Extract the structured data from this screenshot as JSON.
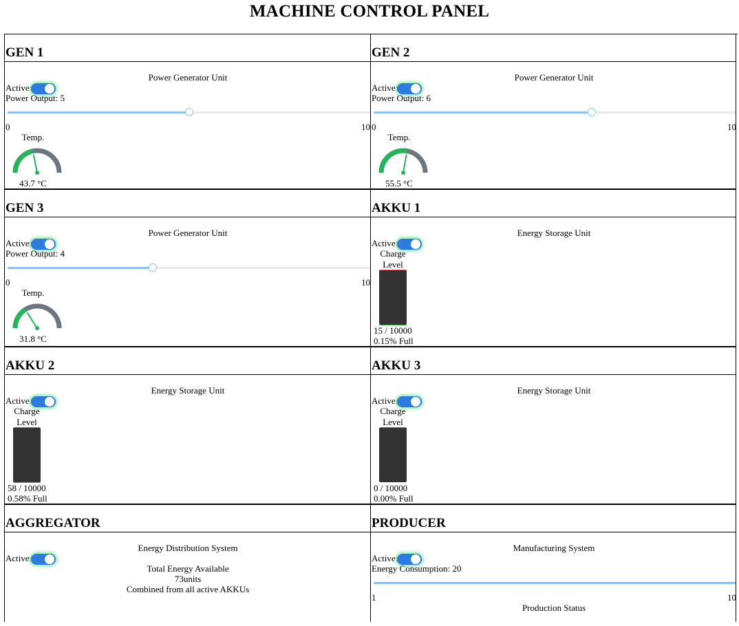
{
  "title": "MACHINE CONTROL PANEL",
  "gens": [
    {
      "name": "GEN 1",
      "subtitle": "Power Generator Unit",
      "active_label": "Active:",
      "active": true,
      "output_label": "Power Output: 5",
      "output": 5,
      "min": "0",
      "max": "10",
      "temp_label": "Temp.",
      "temp": 43.7,
      "temp_text": "43.7 °C"
    },
    {
      "name": "GEN 2",
      "subtitle": "Power Generator Unit",
      "active_label": "Active:",
      "active": true,
      "output_label": "Power Output: 6",
      "output": 6,
      "min": "0",
      "max": "10",
      "temp_label": "Temp.",
      "temp": 55.5,
      "temp_text": "55.5 °C"
    },
    {
      "name": "GEN 3",
      "subtitle": "Power Generator Unit",
      "active_label": "Active:",
      "active": true,
      "output_label": "Power Output: 4",
      "output": 4,
      "min": "0",
      "max": "10",
      "temp_label": "Temp.",
      "temp": 31.8,
      "temp_text": "31.8 °C"
    }
  ],
  "akkus": [
    {
      "name": "AKKU 1",
      "subtitle": "Energy Storage Unit",
      "active_label": "Active:",
      "active": true,
      "charge_label_1": "Charge",
      "charge_label_2": "Level",
      "charge_text": "15 / 10000",
      "charge_fraction": 0.0015,
      "full_text": "0.15% Full"
    },
    {
      "name": "AKKU 2",
      "subtitle": "Energy Storage Unit",
      "active_label": "Active:",
      "active": true,
      "charge_label_1": "Charge",
      "charge_label_2": "Level",
      "charge_text": "58 / 10000",
      "charge_fraction": 0.0058,
      "full_text": "0.58% Full"
    },
    {
      "name": "AKKU 3",
      "subtitle": "Energy Storage Unit",
      "active_label": "Active:",
      "active": true,
      "charge_label_1": "Charge",
      "charge_label_2": "Level",
      "charge_text": "0 / 10000",
      "charge_fraction": 0.0,
      "full_text": "0.00% Full"
    }
  ],
  "aggregator": {
    "name": "AGGREGATOR",
    "subtitle": "Energy Distribution System",
    "active_label": "Active:",
    "active": true,
    "total_label": "Total Energy Available",
    "total_value": "73units",
    "note": "Combined from all active AKKUs"
  },
  "producer": {
    "name": "PRODUCER",
    "subtitle": "Manufacturing System",
    "active_label": "Active:",
    "active": true,
    "consumption_label": "Energy Consumption: 20",
    "consumption_fraction": 1.0,
    "min": "1",
    "max": "10",
    "status_label": "Production Status"
  },
  "colors": {
    "toggle_on": "#2d7be0",
    "toggle_glow": "#7fe8a2",
    "slider": "#8ec1ee",
    "gauge_track": "#6c7580",
    "gauge_ok": "#24b45a",
    "battery": "#333333"
  }
}
